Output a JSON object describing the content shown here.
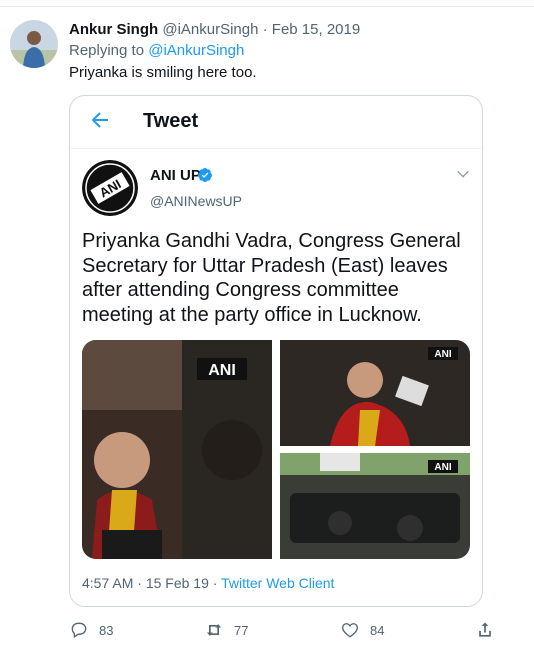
{
  "reply": {
    "author_name": "Ankur Singh",
    "handle": "@iAnkurSingh",
    "separator": "·",
    "date": "Feb 15, 2019",
    "replying_prefix": "Replying to",
    "replying_to": "@iAnkurSingh",
    "text": "Priyanka is smiling here too."
  },
  "embedded": {
    "title": "Tweet",
    "author_name": "ANI UP",
    "handle": "@ANINewsUP",
    "text": "Priyanka Gandhi Vadra, Congress General\nSecretary for Uttar Pradesh (East) leaves\nafter attending Congress committee\nmeeting at the party office in Lucknow.",
    "logo_text": "ANI",
    "watermark": "ANI",
    "time": "4:57 AM",
    "dot": "·",
    "date": "15 Feb 19",
    "client": "Twitter Web Client"
  },
  "actions": {
    "replies": "83",
    "retweets": "77",
    "likes": "84"
  },
  "colors": {
    "link": "#1d9bf0",
    "muted": "#536471",
    "verified": "#1d9bf0"
  }
}
